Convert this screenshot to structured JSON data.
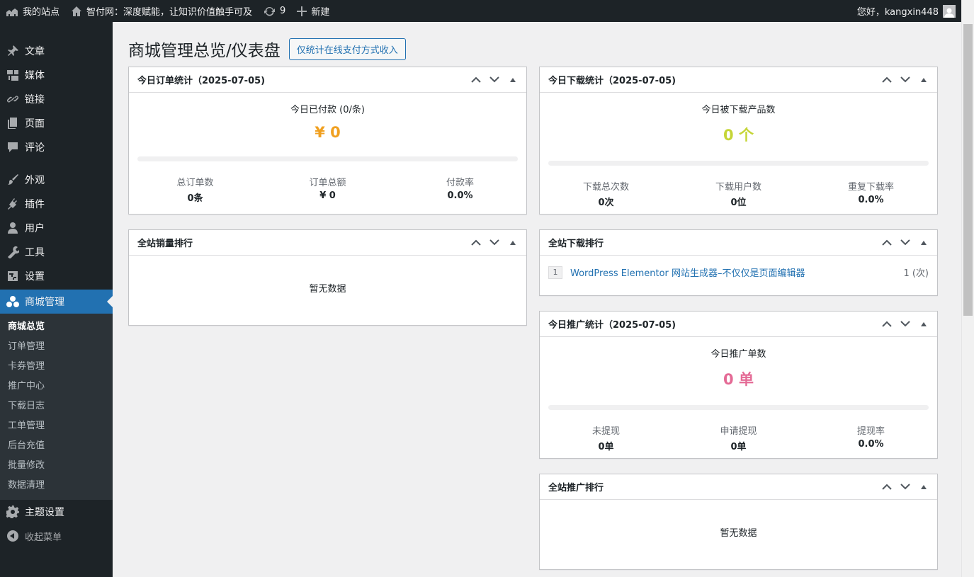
{
  "adminbar": {
    "site": "我的站点",
    "home": "智付网：深度赋能，让知识价值触手可及",
    "updates": "9",
    "new": "新建",
    "greeting": "您好，kangxin448"
  },
  "sidebar": {
    "items": [
      {
        "label": "文章",
        "icon": "pin-icon"
      },
      {
        "label": "媒体",
        "icon": "media-icon"
      },
      {
        "label": "链接",
        "icon": "link-icon"
      },
      {
        "label": "页面",
        "icon": "page-icon"
      },
      {
        "label": "评论",
        "icon": "comment-icon"
      },
      {
        "label": "外观",
        "icon": "brush-icon"
      },
      {
        "label": "插件",
        "icon": "plugin-icon"
      },
      {
        "label": "用户",
        "icon": "user-icon"
      },
      {
        "label": "工具",
        "icon": "wrench-icon"
      },
      {
        "label": "设置",
        "icon": "settings-icon"
      }
    ],
    "current": {
      "label": "商城管理",
      "icon": "shop-icon"
    },
    "submenu": [
      "商城总览",
      "订单管理",
      "卡券管理",
      "推广中心",
      "下载日志",
      "工单管理",
      "后台充值",
      "批量修改",
      "数据清理"
    ],
    "theme": "主题设置",
    "collapse": "收起菜单"
  },
  "page": {
    "title": "商城管理总览/仪表盘",
    "button": "仅统计在线支付方式收入"
  },
  "orders": {
    "title": "今日订单统计（2025-07-05)",
    "label": "今日已付款 (0/条)",
    "big": "¥ 0",
    "progress": 0,
    "stats": [
      {
        "label": "总订单数",
        "value": "0条"
      },
      {
        "label": "订单总额",
        "value": "¥ 0"
      },
      {
        "label": "付款率",
        "value": "0.0%"
      }
    ]
  },
  "sales_rank": {
    "title": "全站销量排行",
    "empty": "暂无数据"
  },
  "downloads": {
    "title": "今日下载统计（2025-07-05)",
    "label": "今日被下载产品数",
    "big": "0 个",
    "progress": 0,
    "stats": [
      {
        "label": "下载总次数",
        "value": "0次"
      },
      {
        "label": "下载用户数",
        "value": "0位"
      },
      {
        "label": "重复下载率",
        "value": "0.0%"
      }
    ]
  },
  "download_rank": {
    "title": "全站下载排行",
    "rows": [
      {
        "rank": "1",
        "title": "WordPress Elementor 网站生成器–不仅仅是页面编辑器",
        "count": "1 (次)"
      }
    ]
  },
  "promo": {
    "title": "今日推广统计（2025-07-05)",
    "label": "今日推广单数",
    "big": "0 单",
    "progress": 0,
    "stats": [
      {
        "label": "未提现",
        "value": "0单"
      },
      {
        "label": "申请提现",
        "value": "0单"
      },
      {
        "label": "提现率",
        "value": "0.0%"
      }
    ]
  },
  "promo_rank": {
    "title": "全站推广排行",
    "empty": "暂无数据"
  },
  "colors": {
    "orders_big": "#f0a020",
    "downloads_big": "#c5d537",
    "promo_big": "#e46a95",
    "accent": "#2271b1"
  }
}
